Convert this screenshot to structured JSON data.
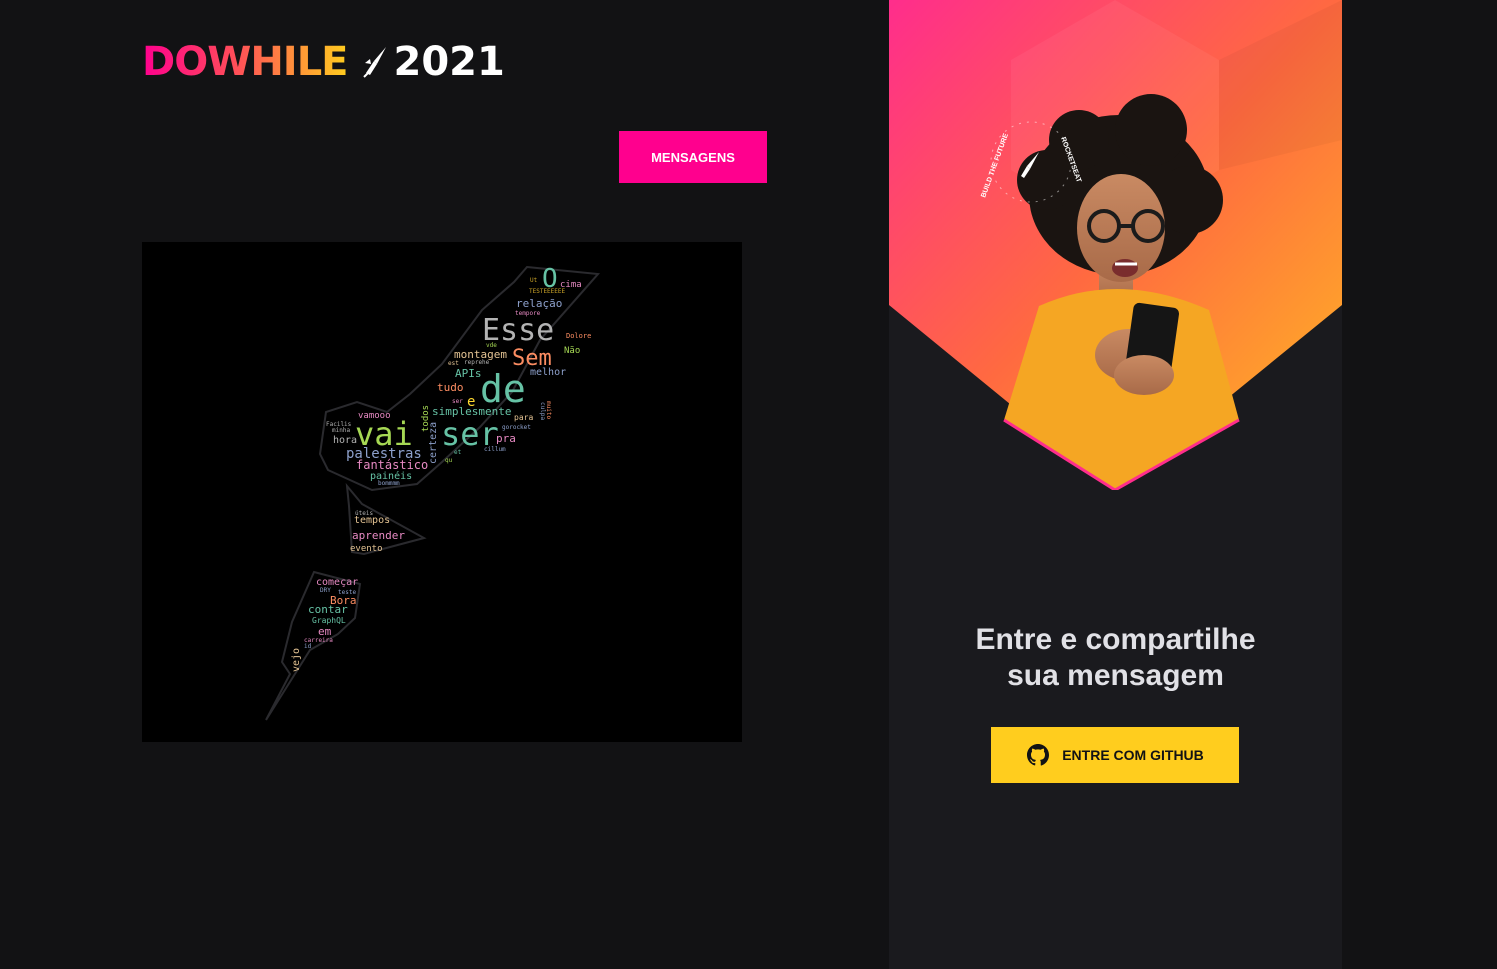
{
  "header": {
    "logo_word": "DOWHILE",
    "logo_year": "2021",
    "messages_label": "MENSAGENS"
  },
  "word_cloud": {
    "words": [
      {
        "text": "Ut",
        "color": "#c9a227"
      },
      {
        "text": "O",
        "color": "#66c2a5"
      },
      {
        "text": "cima",
        "color": "#e78ac3"
      },
      {
        "text": "TESTEEEEEE",
        "color": "#c9a227"
      },
      {
        "text": "relação",
        "color": "#8da0cb"
      },
      {
        "text": "tempore",
        "color": "#e78ac3"
      },
      {
        "text": "Esse",
        "color": "#b3b3b3"
      },
      {
        "text": "Dolore",
        "color": "#fc8d62"
      },
      {
        "text": "vde",
        "color": "#a6d854"
      },
      {
        "text": "montagem",
        "color": "#e5c494"
      },
      {
        "text": "Sem",
        "color": "#fc8d62"
      },
      {
        "text": "Não",
        "color": "#a6d854"
      },
      {
        "text": "est",
        "color": "#e5c494"
      },
      {
        "text": "reprehe",
        "color": "#b3b3b3"
      },
      {
        "text": "melhor",
        "color": "#8da0cb"
      },
      {
        "text": "APIs",
        "color": "#66c2a5"
      },
      {
        "text": "de",
        "color": "#66c2a5"
      },
      {
        "text": "culpa",
        "color": "#8da0cb"
      },
      {
        "text": "muito",
        "color": "#fc8d62"
      },
      {
        "text": "tudo",
        "color": "#fc8d62"
      },
      {
        "text": "ser",
        "color": "#e78ac3"
      },
      {
        "text": "e",
        "color": "#ffd92f"
      },
      {
        "text": "todos",
        "color": "#a6d854"
      },
      {
        "text": "simplesmente",
        "color": "#66c2a5"
      },
      {
        "text": "vamooo",
        "color": "#e78ac3"
      },
      {
        "text": "para",
        "color": "#e5c494"
      },
      {
        "text": "Facilis",
        "color": "#b3b3b3"
      },
      {
        "text": "minha",
        "color": "#b3b3b3"
      },
      {
        "text": "vai",
        "color": "#a6d854"
      },
      {
        "text": "ser",
        "color": "#66c2a5"
      },
      {
        "text": "gorocket",
        "color": "#8da0cb"
      },
      {
        "text": "pra",
        "color": "#e78ac3"
      },
      {
        "text": "hora",
        "color": "#b3b3b3"
      },
      {
        "text": "certeza",
        "color": "#8da0cb"
      },
      {
        "text": "cillum",
        "color": "#8da0cb"
      },
      {
        "text": "palestras",
        "color": "#8da0cb"
      },
      {
        "text": "et",
        "color": "#66c2a5"
      },
      {
        "text": "fantástico",
        "color": "#e78ac3"
      },
      {
        "text": "qu",
        "color": "#a6d854"
      },
      {
        "text": "painéis",
        "color": "#66c2a5"
      },
      {
        "text": "bommmm",
        "color": "#8da0cb"
      },
      {
        "text": "úteis",
        "color": "#b3b3b3"
      },
      {
        "text": "tempos",
        "color": "#e5c494"
      },
      {
        "text": "aprender",
        "color": "#e78ac3"
      },
      {
        "text": "evento",
        "color": "#e5c494"
      },
      {
        "text": "começar",
        "color": "#e78ac3"
      },
      {
        "text": "DRY",
        "color": "#8da0cb"
      },
      {
        "text": "teste",
        "color": "#8da0cb"
      },
      {
        "text": "Bora",
        "color": "#fc8d62"
      },
      {
        "text": "contar",
        "color": "#66c2a5"
      },
      {
        "text": "GraphQL",
        "color": "#66c2a5"
      },
      {
        "text": "em",
        "color": "#e78ac3"
      },
      {
        "text": "carreira",
        "color": "#e78ac3"
      },
      {
        "text": "vejo",
        "color": "#e5c494"
      },
      {
        "text": "id",
        "color": "#8da0cb"
      }
    ]
  },
  "sidebar": {
    "badge_top_text": "BUILD THE FUTURE",
    "badge_side_text": "ROCKETSEAT",
    "heading_line1": "Entre e compartilhe",
    "heading_line2": "sua mensagem",
    "github_button_label": "ENTRE COM GITHUB"
  },
  "colors": {
    "background": "#121214",
    "sidebar_background": "#1a1a1e",
    "pink": "#ff008e",
    "yellow": "#ffcd1e",
    "text": "#e1e1e6"
  }
}
